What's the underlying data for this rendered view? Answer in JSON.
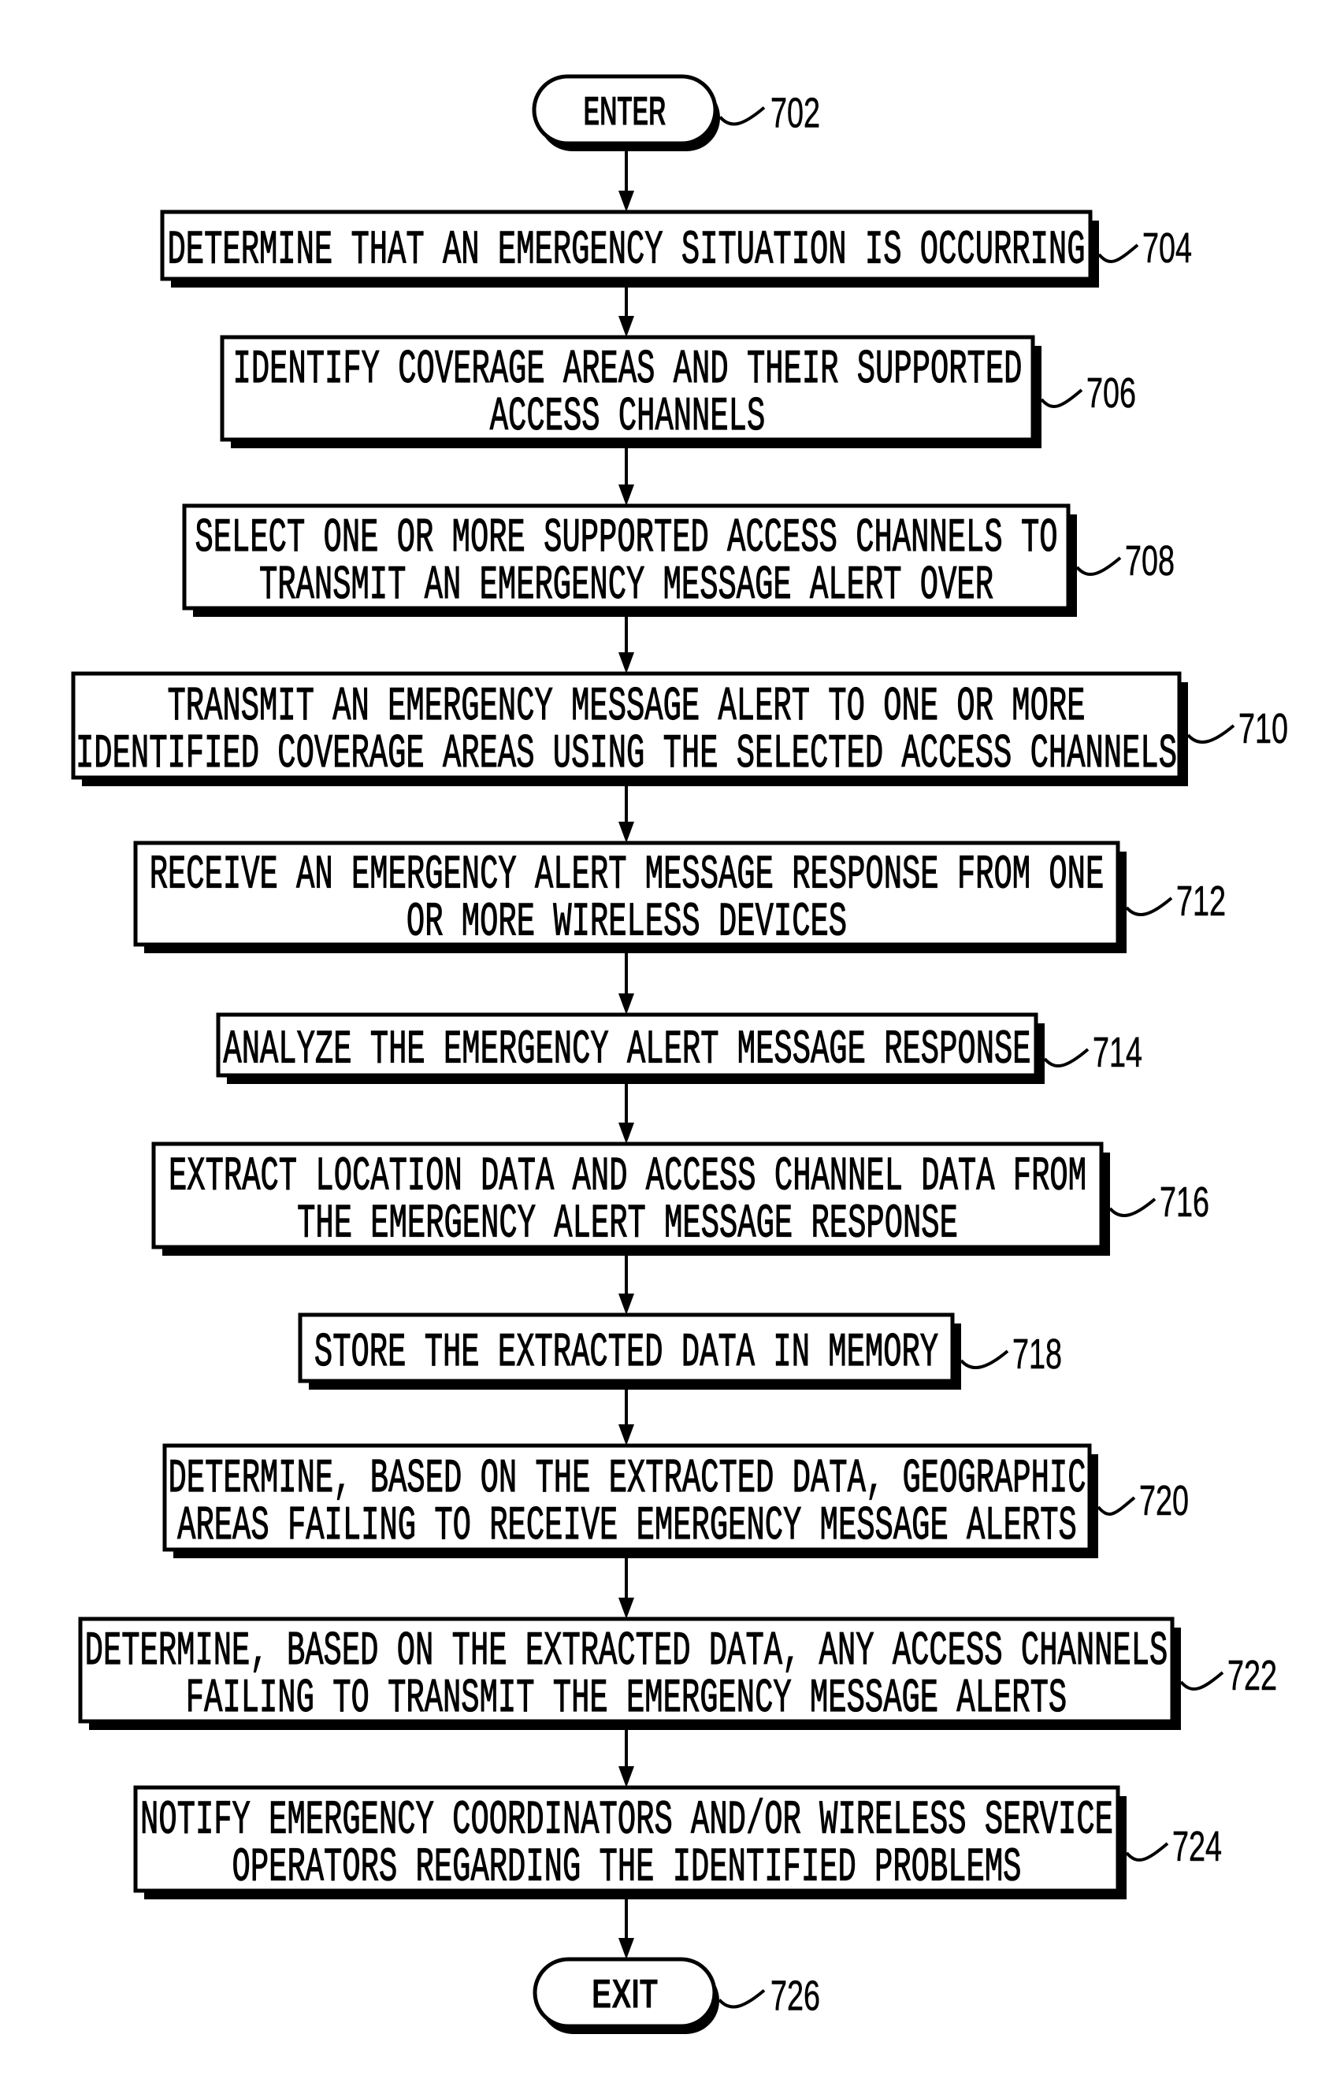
{
  "figure": {
    "type": "flowchart",
    "start": {
      "label": "ENTER",
      "ref": "702"
    },
    "end": {
      "label": "EXIT",
      "ref": "726"
    },
    "steps": [
      {
        "ref": "704",
        "lines": [
          "DETERMINE THAT AN EMERGENCY SITUATION IS OCCURRING"
        ]
      },
      {
        "ref": "706",
        "lines": [
          "IDENTIFY COVERAGE AREAS AND THEIR SUPPORTED",
          "ACCESS CHANNELS"
        ]
      },
      {
        "ref": "708",
        "lines": [
          "SELECT ONE OR MORE SUPPORTED ACCESS CHANNELS TO",
          "TRANSMIT AN EMERGENCY MESSAGE ALERT OVER"
        ]
      },
      {
        "ref": "710",
        "lines": [
          "TRANSMIT AN EMERGENCY MESSAGE ALERT TO ONE OR MORE",
          "IDENTIFIED COVERAGE AREAS USING THE SELECTED ACCESS CHANNELS"
        ]
      },
      {
        "ref": "712",
        "lines": [
          "RECEIVE AN EMERGENCY ALERT MESSAGE RESPONSE FROM ONE",
          "OR MORE WIRELESS DEVICES"
        ]
      },
      {
        "ref": "714",
        "lines": [
          "ANALYZE THE EMERGENCY ALERT MESSAGE RESPONSE"
        ]
      },
      {
        "ref": "716",
        "lines": [
          "EXTRACT LOCATION DATA AND ACCESS CHANNEL DATA FROM",
          "THE EMERGENCY ALERT MESSAGE RESPONSE"
        ]
      },
      {
        "ref": "718",
        "lines": [
          "STORE THE EXTRACTED DATA IN MEMORY"
        ]
      },
      {
        "ref": "720",
        "lines": [
          "DETERMINE, BASED ON THE EXTRACTED DATA, GEOGRAPHIC",
          "AREAS FAILING TO RECEIVE EMERGENCY MESSAGE ALERTS"
        ]
      },
      {
        "ref": "722",
        "lines": [
          "DETERMINE, BASED ON THE EXTRACTED DATA, ANY ACCESS CHANNELS",
          "FAILING TO TRANSMIT THE EMERGENCY MESSAGE ALERTS"
        ]
      },
      {
        "ref": "724",
        "lines": [
          "NOTIFY EMERGENCY COORDINATORS AND/OR WIRELESS SERVICE",
          "OPERATORS REGARDING THE IDENTIFIED PROBLEMS"
        ]
      }
    ]
  },
  "colors": {
    "ink": "#000000",
    "paper": "#ffffff"
  }
}
